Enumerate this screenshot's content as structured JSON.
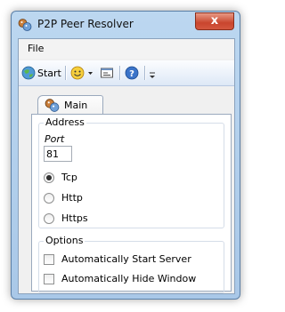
{
  "window": {
    "title": "P2P Peer Resolver",
    "close_glyph": "x"
  },
  "menu": {
    "file_label": "File"
  },
  "toolbar": {
    "start_label": "Start",
    "icons": [
      "globe-start-icon",
      "smiley-icon",
      "dropdown-arrow-icon",
      "window-icon",
      "help-icon",
      "overflow-chevron-icon"
    ]
  },
  "tabs": [
    {
      "label": "Main",
      "icon": "peer-icon"
    }
  ],
  "address": {
    "group_title": "Address",
    "port_label": "Port",
    "port_value": "81",
    "protocols": [
      {
        "label": "Tcp",
        "selected": true
      },
      {
        "label": "Http",
        "selected": false
      },
      {
        "label": "Https",
        "selected": false
      }
    ]
  },
  "options": {
    "group_title": "Options",
    "items": [
      {
        "label": "Automatically Start Server",
        "checked": false
      },
      {
        "label": "Automatically Hide Window",
        "checked": false
      }
    ]
  }
}
